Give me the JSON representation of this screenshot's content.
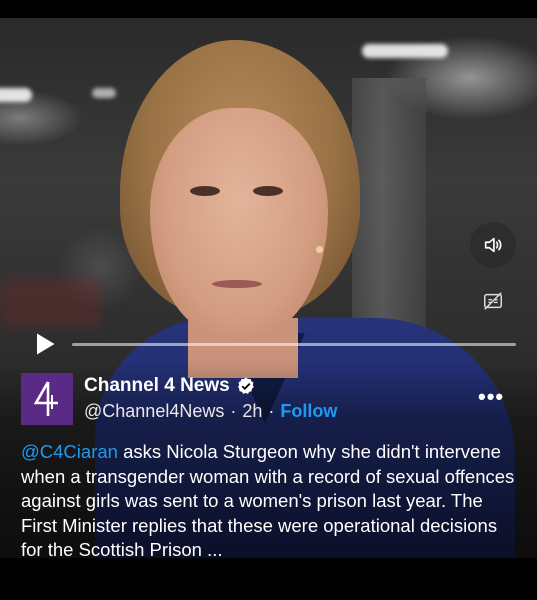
{
  "tweet": {
    "author_name": "Channel 4 News",
    "handle": "@Channel4News",
    "separator": "·",
    "time": "2h",
    "follow_label": "Follow",
    "more_label": "•••",
    "mention": "@C4Ciaran",
    "text": " asks Nicola Sturgeon why she didn't intervene when a transgender woman with a record of sexual offences against girls was sent to a women's prison last year. The First Minister replies that these were operational decisions for the Scottish Prison ...",
    "verified": true
  },
  "video": {
    "progress_fraction": 0.0,
    "controls": {
      "play_icon": "play-icon",
      "sound_icon": "speaker-icon",
      "captions_icon": "captions-off-icon"
    }
  },
  "avatar": {
    "logo_text": "4",
    "background": "#5b2a86"
  },
  "colors": {
    "accent": "#1d9bf0",
    "jacket": "#26337a"
  }
}
